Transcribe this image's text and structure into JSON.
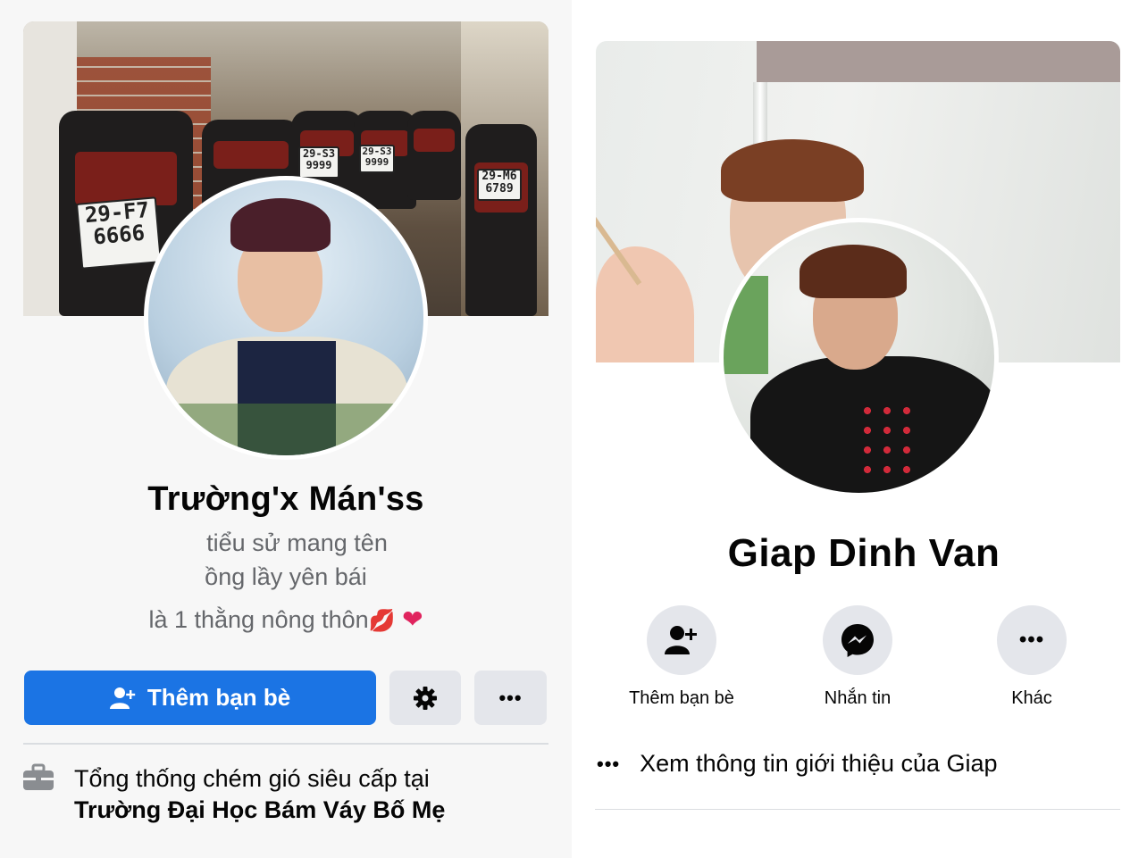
{
  "left_profile": {
    "name": "Trường'x Mán'ss",
    "bio_lines": [
      "tiểu sử mang tên",
      "ồng lầy yên bái",
      "là 1 thằng nông thôn"
    ],
    "bio_emojis": [
      "💋",
      "❤"
    ],
    "cover_plates": [
      "29-F7\n6666",
      "29-S3\n9999",
      "29-S3\n9999",
      "29-M6\n6789"
    ],
    "buttons": {
      "add_friend": "Thêm bạn bè",
      "settings_icon": "gear-icon",
      "more": "•••"
    },
    "work": {
      "line1": "Tổng thống chém gió siêu cấp tại",
      "line2": "Trường Đại Học Bám Váy Bố Mẹ"
    },
    "colors": {
      "primary": "#1b74e4",
      "secondary": "#e4e6eb"
    }
  },
  "right_profile": {
    "name": "Giap Dinh Van",
    "actions": [
      {
        "label": "Thêm bạn bè",
        "icon": "add-friend-icon"
      },
      {
        "label": "Nhắn tin",
        "icon": "messenger-icon"
      },
      {
        "label": "Khác",
        "icon": "more-icon",
        "glyph": "•••"
      }
    ],
    "intro_icon": "•••",
    "intro_text": "Xem thông tin giới thiệu của Giap"
  }
}
